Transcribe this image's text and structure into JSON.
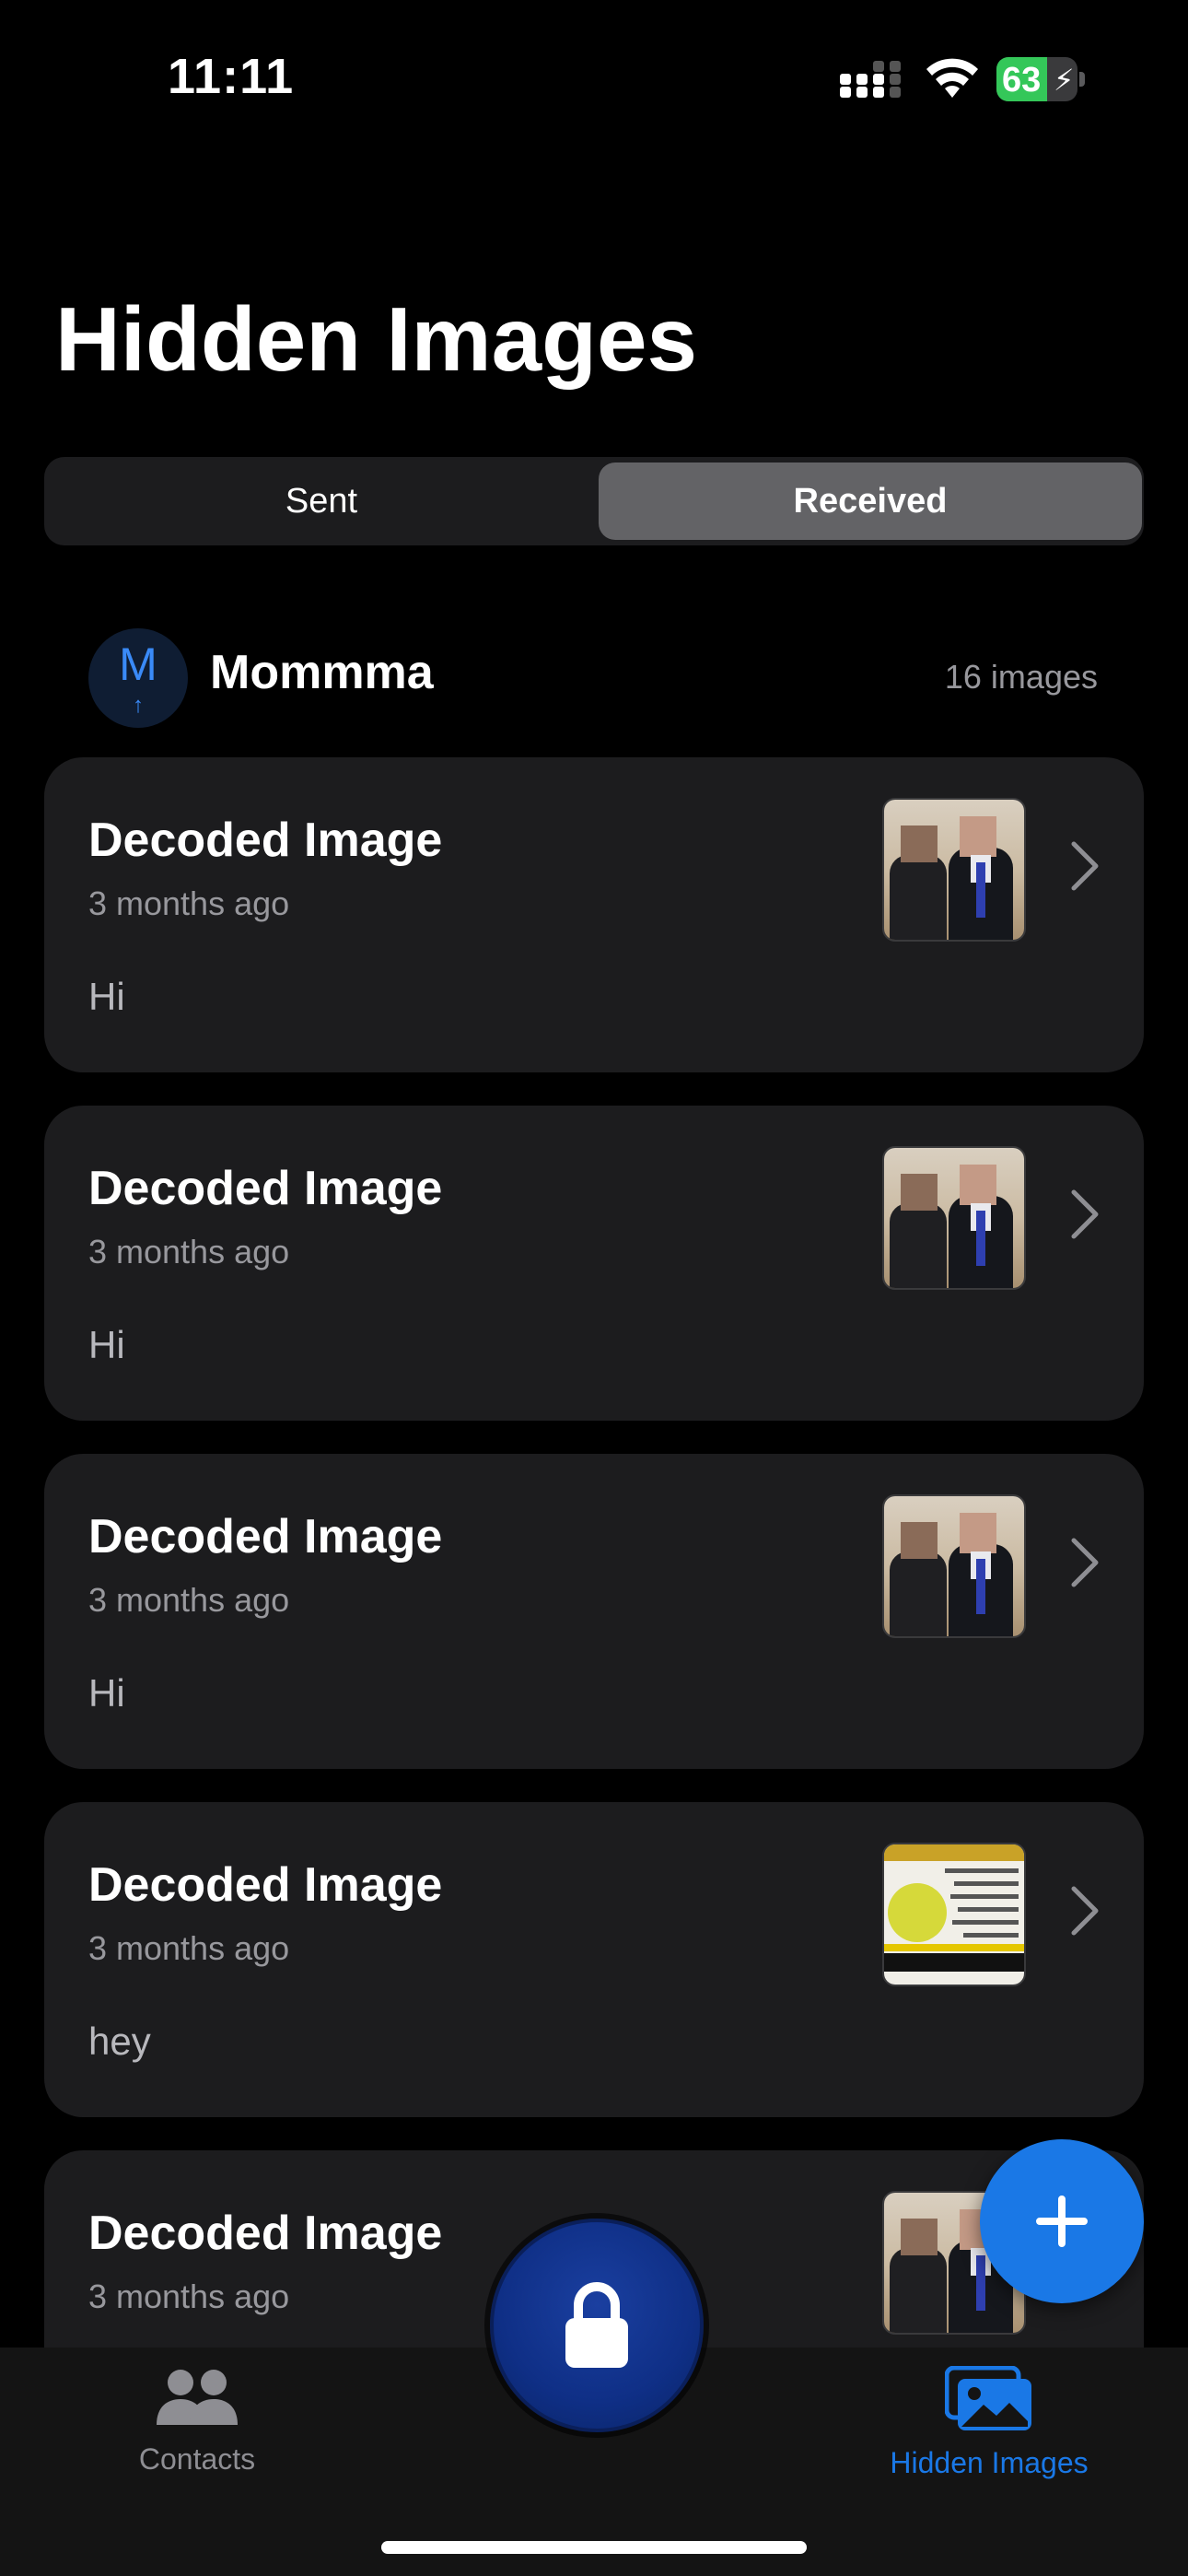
{
  "status_bar": {
    "time": "11:11",
    "battery_percent": "63",
    "battery_level": 0.63
  },
  "header": {
    "title": "Hidden Images"
  },
  "segmented": {
    "options": [
      "Sent",
      "Received"
    ],
    "selected": "Received"
  },
  "contact": {
    "initial": "M",
    "name": "Mommma",
    "count_label": "16 images"
  },
  "cards": [
    {
      "title": "Decoded Image",
      "time": "3 months ago",
      "message": "Hi",
      "thumb": "photo"
    },
    {
      "title": "Decoded Image",
      "time": "3 months ago",
      "message": "Hi",
      "thumb": "photo"
    },
    {
      "title": "Decoded Image",
      "time": "3 months ago",
      "message": "Hi",
      "thumb": "photo"
    },
    {
      "title": "Decoded Image",
      "time": "3 months ago",
      "message": "hey",
      "thumb": "document"
    },
    {
      "title": "Decoded Image",
      "time": "3 months ago",
      "message": "",
      "thumb": "photo"
    }
  ],
  "tabbar": {
    "tabs": [
      {
        "label": "Contacts",
        "icon": "people-icon",
        "active": false
      },
      {
        "label": "Hidden Images",
        "icon": "photos-icon",
        "active": true
      }
    ]
  },
  "colors": {
    "accent": "#1a78e6",
    "card_bg": "#1c1c1e",
    "battery_green": "#34c759"
  }
}
